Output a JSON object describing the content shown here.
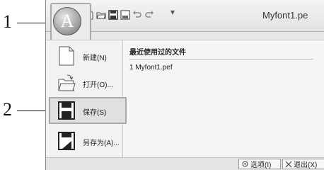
{
  "callouts": [
    {
      "number": "1"
    },
    {
      "number": "2"
    }
  ],
  "app_button": {
    "letter": "A"
  },
  "window": {
    "title": "Myfont1.pe"
  },
  "quick_access": {
    "icons": [
      "new-doc-icon",
      "open-folder-icon",
      "save-icon",
      "save-as-icon",
      "undo-icon",
      "redo-icon",
      "customize-dropdown-icon"
    ],
    "dropdown_glyph": "▾"
  },
  "menu": {
    "items": [
      {
        "label": "新建(N)",
        "icon": "new-doc-icon"
      },
      {
        "label": "打开(O)...",
        "icon": "open-folder-icon"
      },
      {
        "label": "保存(S)",
        "icon": "save-icon"
      },
      {
        "label": "另存为(A)...",
        "icon": "save-as-icon"
      }
    ]
  },
  "recent": {
    "header": "最近使用过的文件",
    "files": [
      {
        "label": "1 Myfont1.pef"
      }
    ]
  },
  "bottom": {
    "options_label": "选项(I)",
    "exit_label": "退出(X)"
  }
}
